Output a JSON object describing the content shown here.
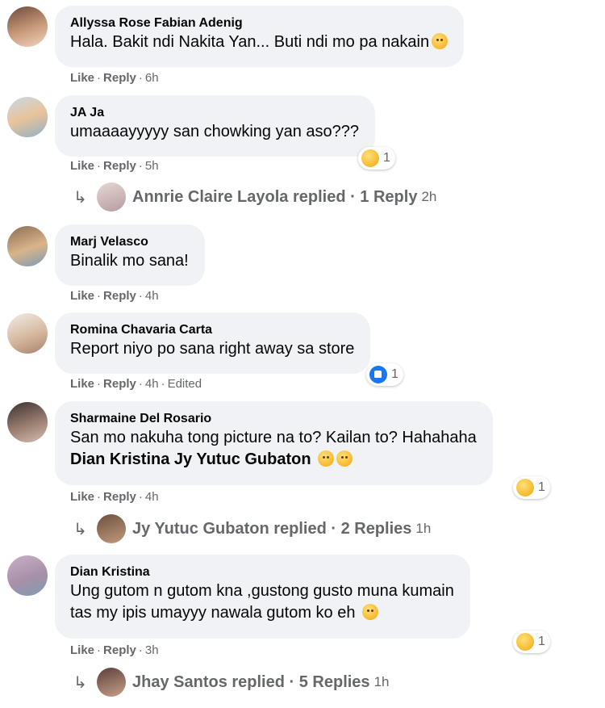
{
  "comments": [
    {
      "name": "Allyssa Rose Fabian Adenig",
      "text": "Hala. Bakit ndi Nakita Yan... Buti ndi mo pa nakain",
      "emoji": "sad-face-emoji",
      "like": "Like",
      "reply": "Reply",
      "time": "6h"
    },
    {
      "name": "JA Ja",
      "text": "umaaaayyyyy san chowking yan aso???",
      "like": "Like",
      "reply": "Reply",
      "time": "5h",
      "reaction": {
        "icon": "sad-reaction-icon",
        "count": "1"
      },
      "replies": {
        "label": "Annrie Claire Layola replied · 1 Reply",
        "time": "2h"
      }
    },
    {
      "name": "Marj Velasco",
      "text": "Binalik mo sana!",
      "like": "Like",
      "reply": "Reply",
      "time": "4h"
    },
    {
      "name": "Romina Chavaria Carta",
      "text": "Report niyo po sana right away sa store",
      "like": "Like",
      "reply": "Reply",
      "time": "4h",
      "edited": "Edited",
      "reaction": {
        "icon": "like-reaction-icon",
        "count": "1"
      }
    },
    {
      "name": "Sharmaine Del Rosario",
      "text": "San mo nakuha tong picture na to? Kailan to? Hahahaha",
      "mention": "Dian Kristina Jy Yutuc Gubaton",
      "like": "Like",
      "reply": "Reply",
      "time": "4h",
      "reaction": {
        "icon": "haha-reaction-icon",
        "count": "1"
      },
      "replies": {
        "label": "Jy Yutuc Gubaton replied · 2 Replies",
        "time": "1h"
      }
    },
    {
      "name": "Dian Kristina",
      "text": "Ung gutom n gutom kna ,gustong gusto muna kumain",
      "text2": "tas my ipis umayyy nawala gutom ko eh",
      "like": "Like",
      "reply": "Reply",
      "time": "3h",
      "reaction": {
        "icon": "sad-reaction-icon",
        "count": "1"
      },
      "replies": {
        "label": "Jhay Santos replied · 5 Replies",
        "time": "1h"
      }
    }
  ],
  "colors": {
    "bubble": "#f0f2f5",
    "meta": "#65676b",
    "like_blue": "#1877f2"
  }
}
